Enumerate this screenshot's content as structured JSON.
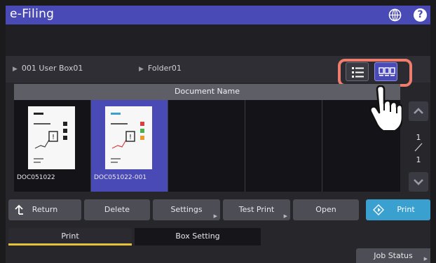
{
  "header": {
    "title": "e-Filing",
    "help_label": "?"
  },
  "breadcrumb": {
    "box": "001 User Box01",
    "folder": "Folder01"
  },
  "view_toggle": {
    "list_icon": "list-view-icon",
    "thumbnail_icon": "thumbnail-view-icon",
    "selected": "thumbnail",
    "highlight_color": "#ee7d6e"
  },
  "table": {
    "column_header": "Document Name",
    "documents": [
      {
        "name": "DOC051022",
        "selected": false
      },
      {
        "name": "DOC051022-001",
        "selected": true
      }
    ]
  },
  "pagination": {
    "current": "1",
    "total": "1"
  },
  "actions": {
    "return_label": "Return",
    "delete_label": "Delete",
    "settings_label": "Settings",
    "test_print_label": "Test Print",
    "open_label": "Open",
    "print_label": "Print"
  },
  "tabs": [
    {
      "label": "Print",
      "active": true
    },
    {
      "label": "Box Setting",
      "active": false
    }
  ],
  "footer": {
    "job_status_label": "Job Status"
  },
  "colors": {
    "accent": "#4a4ab7",
    "print_button": "#3aa0d0",
    "active_tab_underline": "#e7c23c"
  }
}
